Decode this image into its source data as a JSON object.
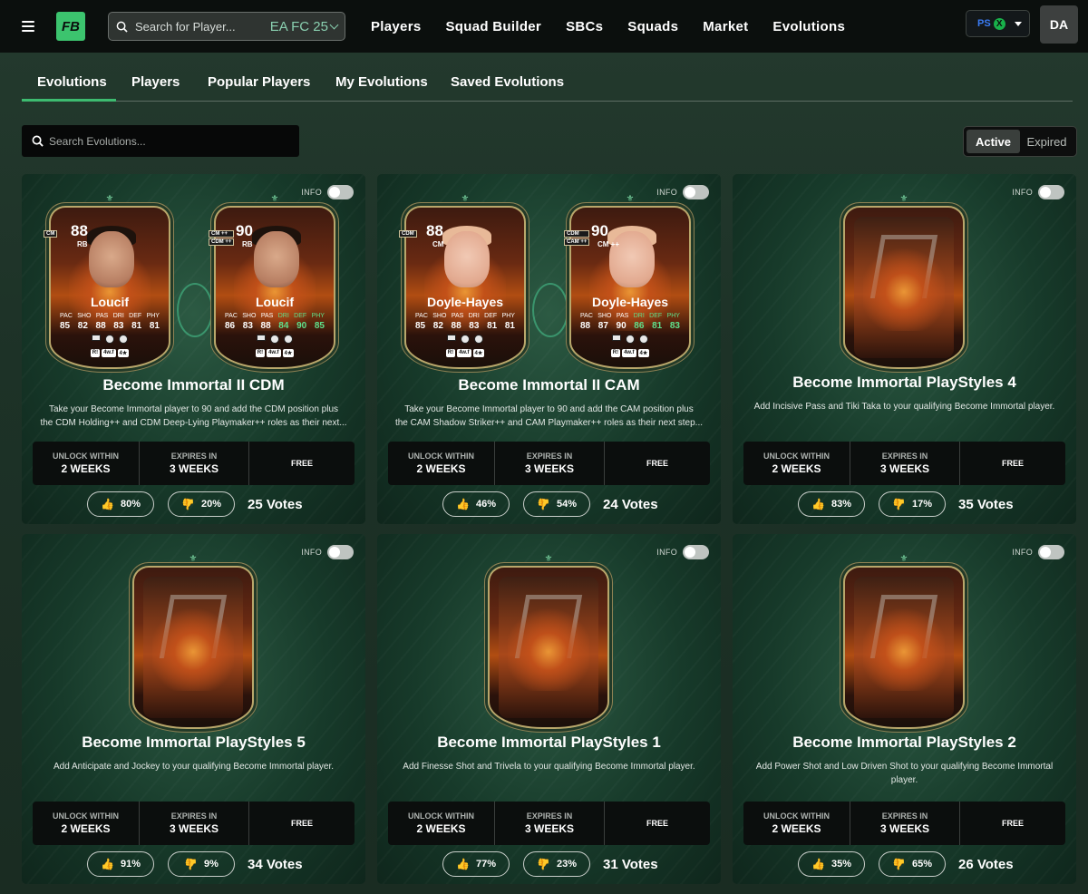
{
  "topbar": {
    "search_placeholder": "Search for Player...",
    "game_version": "EA FC 25",
    "nav": [
      "Players",
      "Squad Builder",
      "SBCs",
      "Squads",
      "Market",
      "Evolutions"
    ],
    "platform_icons": [
      "playstation-icon",
      "xbox-icon"
    ],
    "user_initials": "DA"
  },
  "subtabs": {
    "items": [
      "Evolutions",
      "Players",
      "Popular Players",
      "My Evolutions",
      "Saved Evolutions"
    ],
    "active": "Evolutions"
  },
  "evolution_search": {
    "placeholder": "Search Evolutions..."
  },
  "status_filter": {
    "options": [
      "Active",
      "Expired"
    ],
    "selected": "Active"
  },
  "labels": {
    "info": "INFO",
    "unlock_within": "UNLOCK WITHIN",
    "expires_in": "EXPIRES IN",
    "votes_suffix": "Votes"
  },
  "cards": [
    {
      "title": "Become Immortal II CDM",
      "desc_line1": "Take your Become Immortal player to 90 and add the CDM position plus",
      "desc_line2": "the CDM Holding++ and CDM Deep-Lying Playmaker++ roles as their next...",
      "unlock": "2 WEEKS",
      "expires": "3 WEEKS",
      "cost": "FREE",
      "up": "80%",
      "down": "20%",
      "votes": "25 Votes",
      "players": [
        {
          "name": "Loucif",
          "rating": "88",
          "position": "RB",
          "alt_positions": [
            "CM"
          ],
          "stat_labels": [
            "PAC",
            "SHO",
            "PAS",
            "DRI",
            "DEF",
            "PHY"
          ],
          "stats": [
            "85",
            "82",
            "88",
            "83",
            "81",
            "81"
          ],
          "tags": [
            "R!",
            "4w.f",
            "4★"
          ]
        },
        {
          "name": "Loucif",
          "rating": "90",
          "position": "RB",
          "alt_positions": [
            "CM ++",
            "CDM ++"
          ],
          "stat_labels": [
            "PAC",
            "SHO",
            "PAS",
            "DRI",
            "DEF",
            "PHY"
          ],
          "stats": [
            "86",
            "83",
            "88",
            "84",
            "90",
            "85"
          ],
          "tags": [
            "R!",
            "4w.f",
            "4★"
          ]
        }
      ]
    },
    {
      "title": "Become Immortal II CAM",
      "desc_line1": "Take your Become Immortal player to 90 and add the CAM position plus",
      "desc_line2": "the CAM Shadow Striker++ and CAM Playmaker++ roles as their next step...",
      "unlock": "2 WEEKS",
      "expires": "3 WEEKS",
      "cost": "FREE",
      "up": "46%",
      "down": "54%",
      "votes": "24 Votes",
      "players": [
        {
          "name": "Doyle-Hayes",
          "rating": "88",
          "position": "CM",
          "alt_positions": [
            "CDM"
          ],
          "stat_labels": [
            "PAC",
            "SHO",
            "PAS",
            "DRI",
            "DEF",
            "PHY"
          ],
          "stats": [
            "85",
            "82",
            "88",
            "83",
            "81",
            "81"
          ],
          "tags": [
            "R!",
            "4w.f",
            "4★"
          ]
        },
        {
          "name": "Doyle-Hayes",
          "rating": "90",
          "position": "CM ++",
          "alt_positions": [
            "CDM",
            "CAM ++"
          ],
          "stat_labels": [
            "PAC",
            "SHO",
            "PAS",
            "DRI",
            "DEF",
            "PHY"
          ],
          "stats": [
            "88",
            "87",
            "90",
            "86",
            "81",
            "83"
          ],
          "tags": [
            "R!",
            "4w.f",
            "4★"
          ]
        }
      ]
    },
    {
      "title": "Become Immortal PlayStyles 4",
      "desc_line1": "Add Incisive Pass and Tiki Taka to your qualifying Become Immortal player.",
      "desc_line2": "",
      "unlock": "2 WEEKS",
      "expires": "3 WEEKS",
      "cost": "FREE",
      "up": "83%",
      "down": "17%",
      "votes": "35 Votes"
    },
    {
      "title": "Become Immortal PlayStyles 5",
      "desc_line1": "Add Anticipate and Jockey to your qualifying Become Immortal player.",
      "desc_line2": "",
      "unlock": "2 WEEKS",
      "expires": "3 WEEKS",
      "cost": "FREE",
      "up": "91%",
      "down": "9%",
      "votes": "34 Votes"
    },
    {
      "title": "Become Immortal PlayStyles 1",
      "desc_line1": "Add Finesse Shot and Trivela to your qualifying Become Immortal player.",
      "desc_line2": "",
      "unlock": "2 WEEKS",
      "expires": "3 WEEKS",
      "cost": "FREE",
      "up": "77%",
      "down": "23%",
      "votes": "31 Votes"
    },
    {
      "title": "Become Immortal PlayStyles 2",
      "desc_line1": "Add Power Shot and Low Driven Shot to your qualifying Become Immortal",
      "desc_line2": "player.",
      "unlock": "2 WEEKS",
      "expires": "3 WEEKS",
      "cost": "FREE",
      "up": "35%",
      "down": "65%",
      "votes": "26 Votes"
    }
  ],
  "colors": {
    "accent": "#3dbb70",
    "topbar": "#0b0f0d",
    "logo": "#3cc46e"
  }
}
